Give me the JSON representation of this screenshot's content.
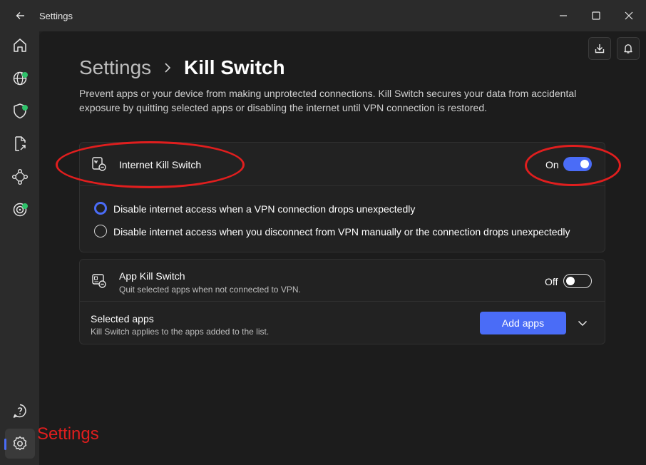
{
  "titlebar": {
    "title": "Settings"
  },
  "sidebar": {
    "items": [
      {
        "name": "home-icon"
      },
      {
        "name": "globe-icon",
        "badge": true
      },
      {
        "name": "shield-icon",
        "badge": true
      },
      {
        "name": "file-share-icon"
      },
      {
        "name": "network-icon"
      },
      {
        "name": "target-icon",
        "badge": true
      },
      {
        "name": "help-icon"
      },
      {
        "name": "gear-icon",
        "active": true
      }
    ]
  },
  "breadcrumb": {
    "parent": "Settings",
    "current": "Kill Switch"
  },
  "description": "Prevent apps or your device from making unprotected connections. Kill Switch secures your data from accidental exposure by quitting selected apps or disabling the internet until VPN connection is restored.",
  "internet_kill_switch": {
    "title": "Internet Kill Switch",
    "toggle_label": "On",
    "enabled": true,
    "options": [
      {
        "label": "Disable internet access when a VPN connection drops unexpectedly",
        "checked": true
      },
      {
        "label": "Disable internet access when you disconnect from VPN manually or the connection drops unexpectedly",
        "checked": false
      }
    ]
  },
  "app_kill_switch": {
    "title": "App Kill Switch",
    "subtitle": "Quit selected apps when not connected to VPN.",
    "toggle_label": "Off",
    "enabled": false,
    "selected_apps_title": "Selected apps",
    "selected_apps_subtitle": "Kill Switch applies to the apps added to the list.",
    "add_button": "Add apps"
  },
  "annotation": {
    "text": "Settings",
    "color": "#e01e1e"
  },
  "colors": {
    "accent": "#4a6cf7",
    "badge": "#2fc36b"
  }
}
